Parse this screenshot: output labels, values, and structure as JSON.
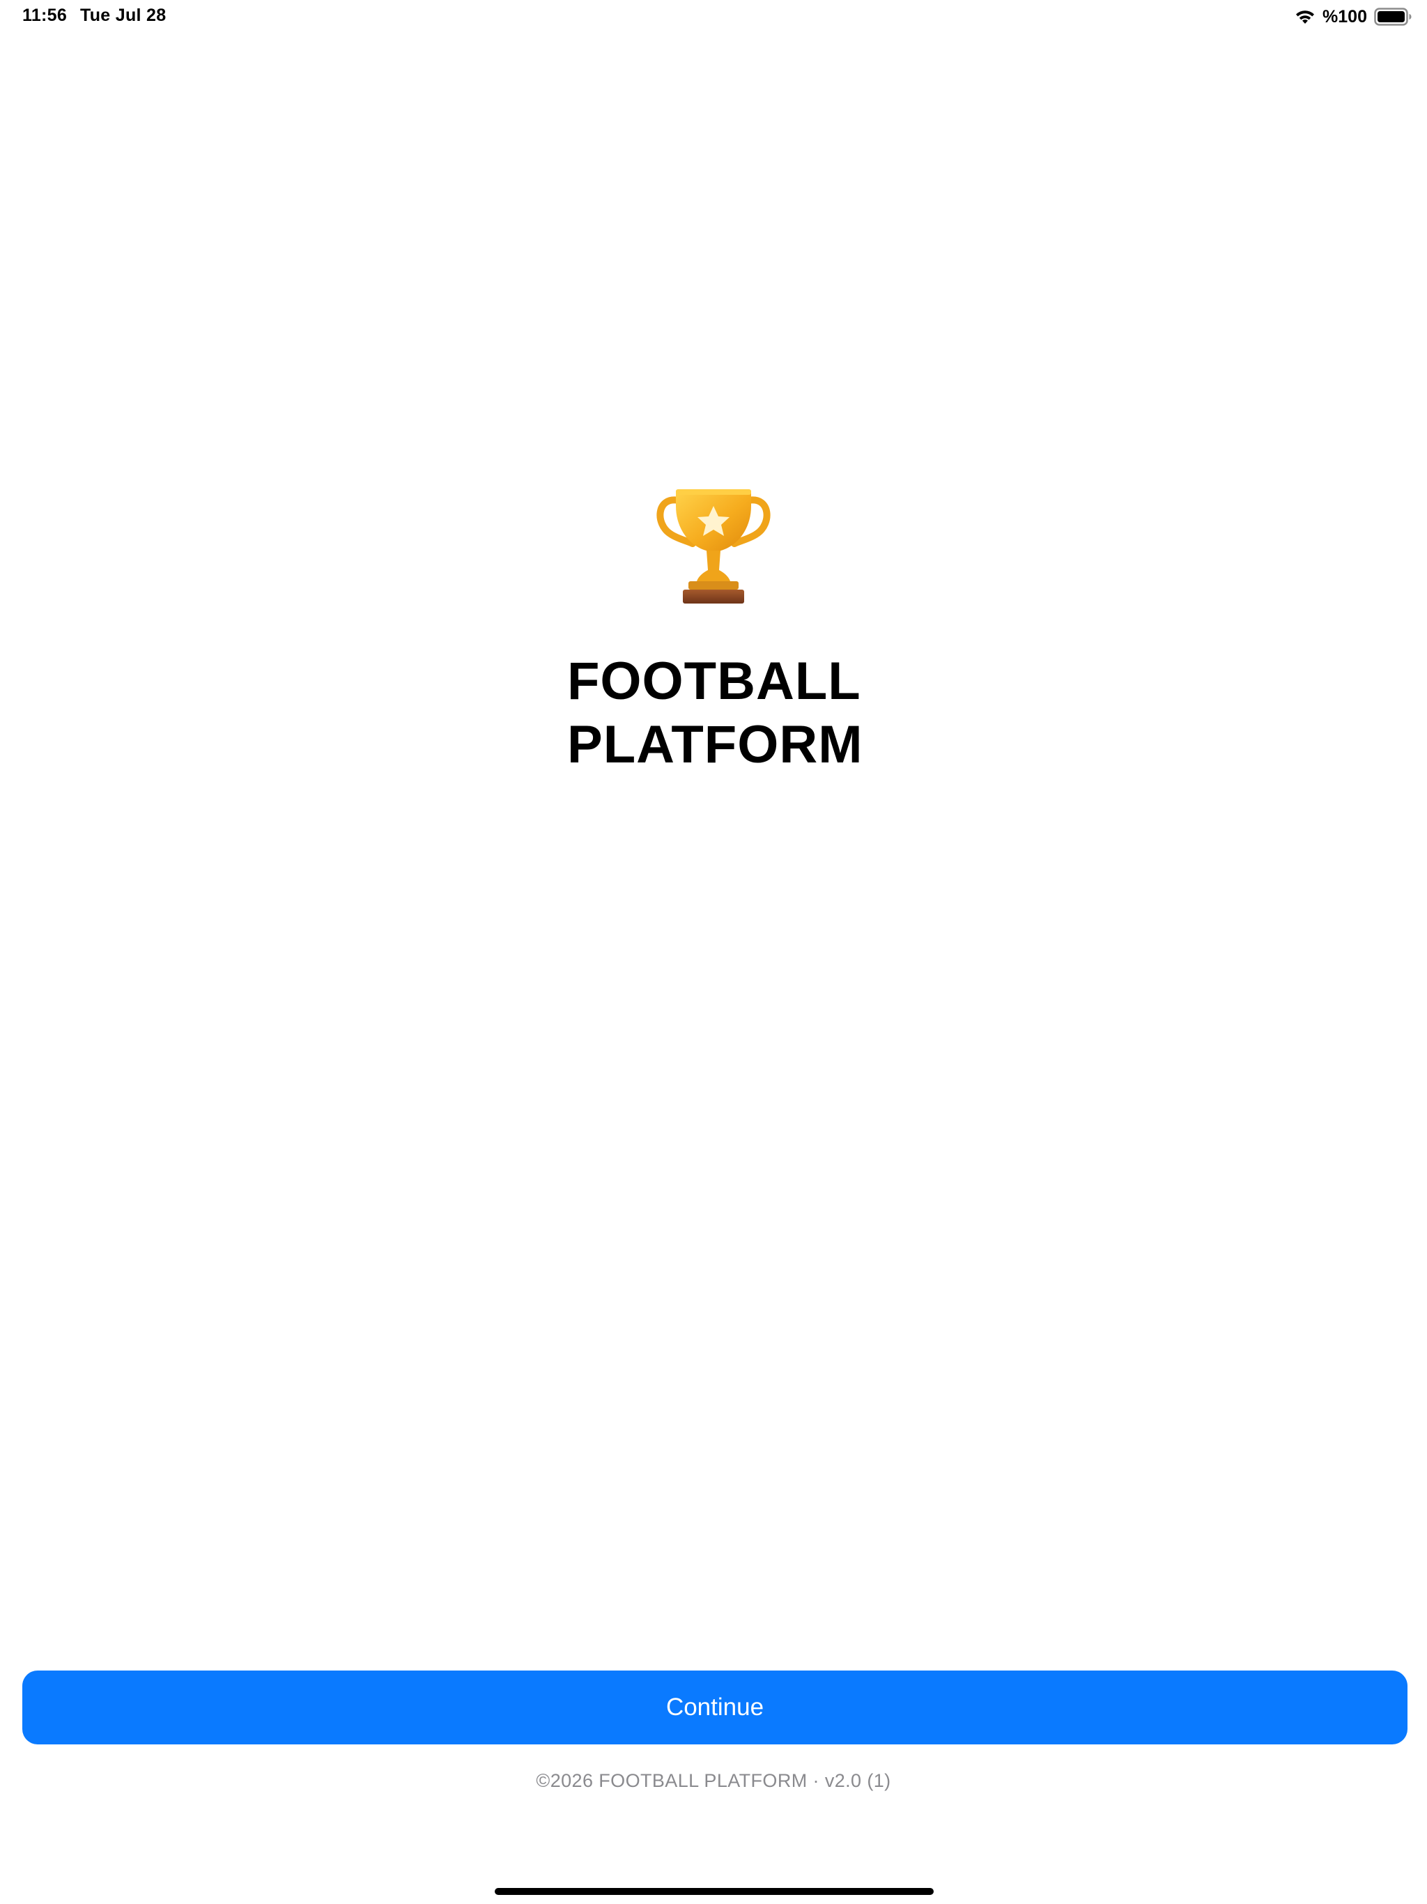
{
  "status_bar": {
    "time": "11:56",
    "date": "Tue Jul 28",
    "battery_text": "%100",
    "wifi_icon": "wifi-icon",
    "battery_icon": "battery-full-icon"
  },
  "hero": {
    "icon": "trophy-icon",
    "title": "FOOTBALL PLATFORM"
  },
  "actions": {
    "continue_label": "Continue"
  },
  "footer": {
    "text": "©2026 FOOTBALL PLATFORM · v2.0 (1)"
  },
  "colors": {
    "accent": "#0a7aff",
    "footer_text": "#8a8a8e",
    "trophy_gold": "#f7b52b",
    "trophy_base": "#8a4a25"
  }
}
